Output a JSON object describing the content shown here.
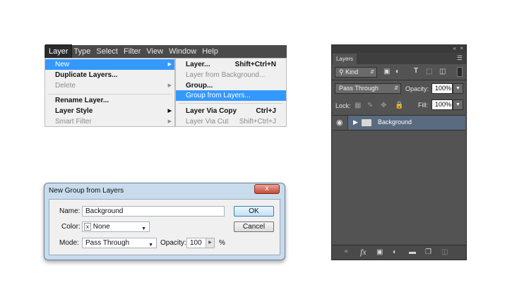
{
  "menubar": {
    "items": [
      "Layer",
      "Type",
      "Select",
      "Filter",
      "View",
      "Window",
      "Help"
    ]
  },
  "layer_menu": {
    "new": "New",
    "duplicate": "Duplicate Layers...",
    "delete": "Delete",
    "rename": "Rename Layer...",
    "style": "Layer Style",
    "smart_filter": "Smart Filter"
  },
  "new_submenu": {
    "layer": "Layer...",
    "layer_shortcut": "Shift+Ctrl+N",
    "layer_from_bg": "Layer from Background...",
    "group": "Group...",
    "group_from_layers": "Group from Layers...",
    "via_copy": "Layer Via Copy",
    "via_copy_shortcut": "Ctrl+J",
    "via_cut": "Layer Via Cut",
    "via_cut_shortcut": "Shift+Ctrl+J"
  },
  "dialog": {
    "title": "New Group from Layers",
    "close": "x",
    "name_label": "Name:",
    "name_value": "Background",
    "color_label": "Color:",
    "color_value": "None",
    "color_x": "x",
    "mode_label": "Mode:",
    "mode_value": "Pass Through",
    "opacity_label": "Opacity:",
    "opacity_value": "100",
    "opacity_unit": "%",
    "ok": "OK",
    "cancel": "Cancel"
  },
  "layers_panel": {
    "tab": "Layers",
    "filter_kind": "Kind",
    "blend_mode": "Pass Through",
    "opacity_label": "Opacity:",
    "opacity_value": "100%",
    "lock_label": "Lock:",
    "fill_label": "Fill:",
    "fill_value": "100%",
    "layer_name": "Background",
    "fx": "fx"
  }
}
